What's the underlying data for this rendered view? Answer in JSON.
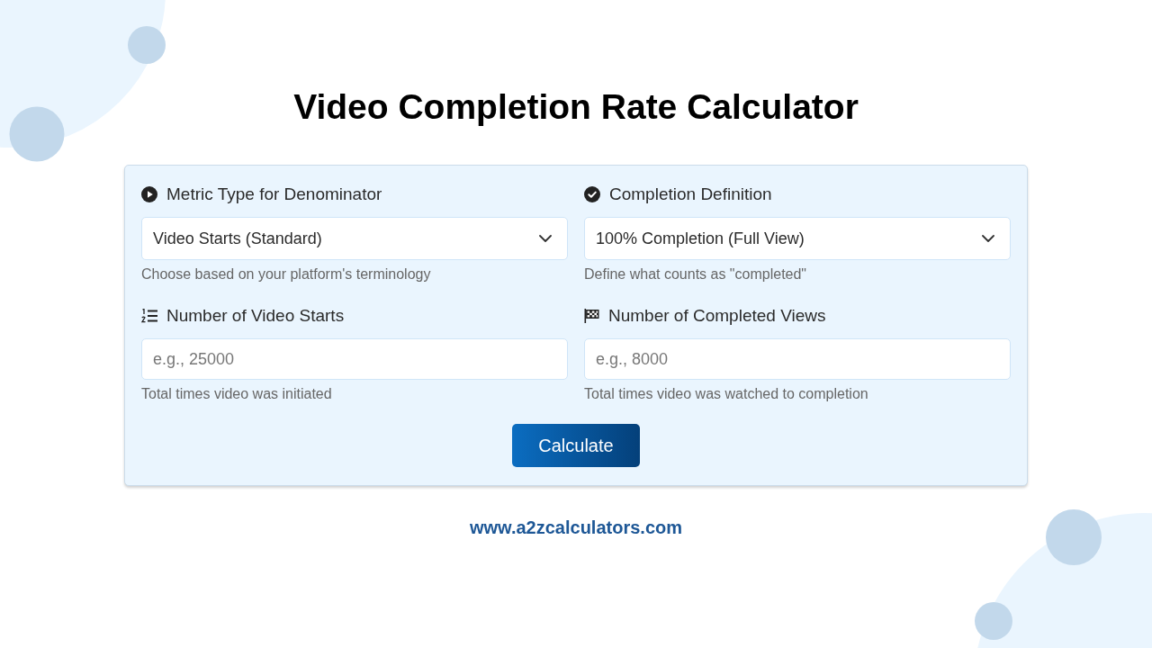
{
  "title": "Video Completion Rate Calculator",
  "form": {
    "fields": [
      {
        "kind": "select",
        "label": "Metric Type for Denominator",
        "value": "Video Starts (Standard)",
        "help": "Choose based on your platform's terminology"
      },
      {
        "kind": "select",
        "label": "Completion Definition",
        "value": "100% Completion (Full View)",
        "help": "Define what counts as \"completed\""
      },
      {
        "kind": "number",
        "label": "Number of Video Starts",
        "placeholder": "e.g., 25000",
        "help": "Total times video was initiated"
      },
      {
        "kind": "number",
        "label": "Number of Completed Views",
        "placeholder": "e.g., 8000",
        "help": "Total times video was watched to completion"
      }
    ],
    "button": "Calculate"
  },
  "footer": {
    "link": "www.a2zcalculators.com"
  }
}
